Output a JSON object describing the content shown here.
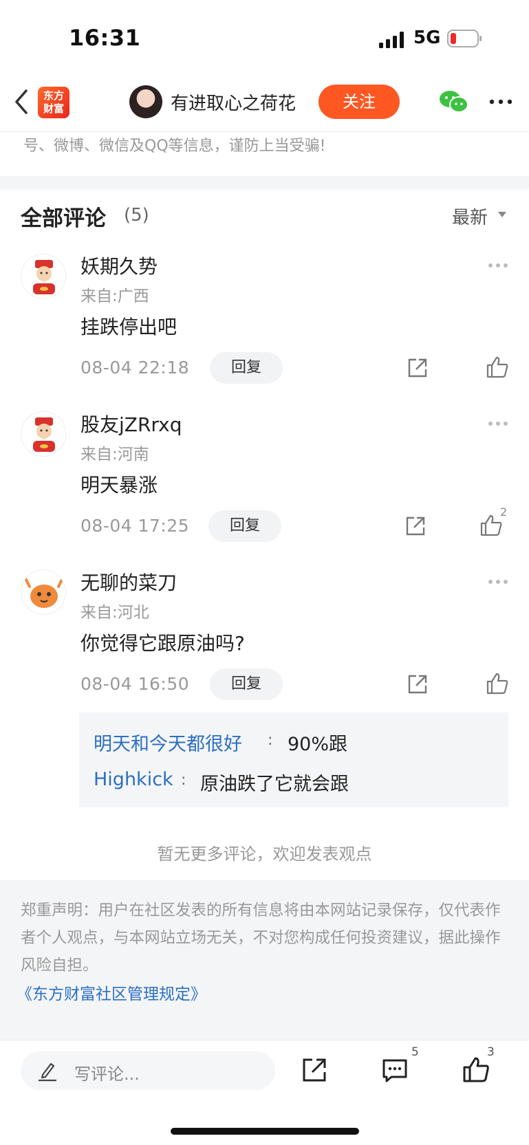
{
  "status_bar": {
    "time": "16:31",
    "network": "5G"
  },
  "header": {
    "logo_text_line1": "东方",
    "logo_text_line2": "财富",
    "author_name": "有进取心之荷花",
    "follow_label": "关注"
  },
  "notice_text": "号、微博、微信及QQ等信息，谨防上当受骗!",
  "comments_section": {
    "title": "全部评论",
    "count": "(5)",
    "sort_label": "最新"
  },
  "comments": [
    {
      "name": "妖期久势",
      "location": "来自:广西",
      "text": "挂跌停出吧",
      "time": "08-04 22:18",
      "reply_label": "回复",
      "likes": ""
    },
    {
      "name": "股友jZRrxq",
      "location": "来自:河南",
      "text": "明天暴涨",
      "time": "08-04 17:25",
      "reply_label": "回复",
      "likes": "2"
    },
    {
      "name": "无聊的菜刀",
      "location": "来自:河北",
      "text": "你觉得它跟原油吗?",
      "time": "08-04 16:50",
      "reply_label": "回复",
      "likes": ""
    }
  ],
  "sub_replies": [
    {
      "user": "明天和今天都很好",
      "text": "90%跟"
    },
    {
      "user": "Highkick",
      "text": "原油跌了它就会跟"
    }
  ],
  "no_more_text": "暂无更多评论，欢迎发表观点",
  "disclaimer": {
    "text": "郑重声明：用户在社区发表的所有信息将由本网站记录保存，仅代表作者个人观点，与本网站立场无关，不对您构成任何投资建议，据此操作风险自担。",
    "link": "《东方财富社区管理规定》"
  },
  "bottom_bar": {
    "write_placeholder": "写评论...",
    "comment_count": "5",
    "like_count": "3"
  },
  "colors": {
    "accent": "#ff5722",
    "link": "#2b6fc2",
    "wechat": "#3cc240"
  },
  "icons": [
    "back-chevron-icon",
    "wechat-icon",
    "more-icon",
    "share-icon",
    "like-icon",
    "comment-icon",
    "pen-icon"
  ]
}
